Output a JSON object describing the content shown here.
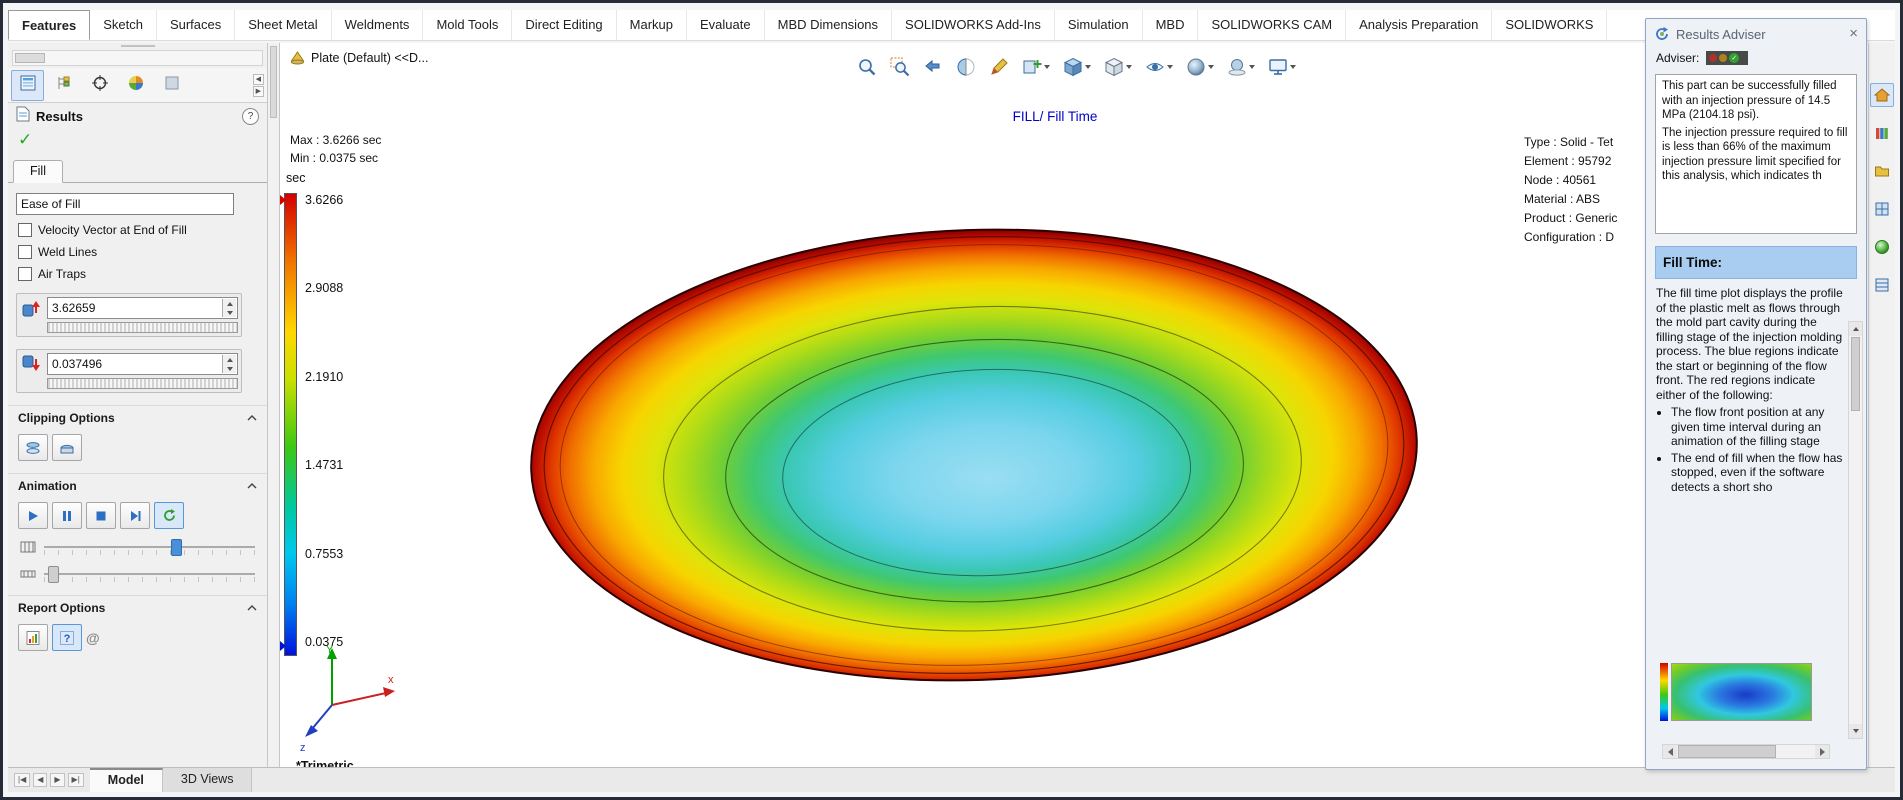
{
  "colors": {
    "plot_title_blue": "#0000cc",
    "legend_top_red": "#d40000",
    "legend_bottom_blue": "#0011dd",
    "adviser_header_bg": "#a9cdf0",
    "success_green": "#1faa1f"
  },
  "ribbon": {
    "tabs": [
      "Features",
      "Sketch",
      "Surfaces",
      "Sheet Metal",
      "Weldments",
      "Mold Tools",
      "Direct Editing",
      "Markup",
      "Evaluate",
      "MBD Dimensions",
      "SOLIDWORKS Add-Ins",
      "Simulation",
      "MBD",
      "SOLIDWORKS CAM",
      "Analysis Preparation",
      "SOLIDWORKS"
    ]
  },
  "panel": {
    "title": "Results",
    "help": "?",
    "check_glyph": "✓",
    "fill_tab": "Fill",
    "ease_of_fill": "Ease of Fill",
    "check_velocity": "Velocity Vector at End of Fill",
    "check_weld": "Weld Lines",
    "check_air": "Air Traps",
    "max_value": "3.62659",
    "min_value": "0.037496",
    "clipping_header": "Clipping Options",
    "animation_header": "Animation",
    "report_header": "Report Options",
    "at_glyph": "@",
    "tab_nav_left": "◀",
    "tab_nav_right": "▶"
  },
  "viewport": {
    "breadcrumb": "Plate (Default) <<D...",
    "plot_title": "FILL/ Fill Time",
    "max_text": "Max : 3.6266 sec",
    "min_text": "Min : 0.0375 sec",
    "view_name": "*Trimetric",
    "legend_unit": "sec",
    "legend_ticks": [
      "3.6266",
      "2.9088",
      "2.1910",
      "1.4731",
      "0.7553",
      "0.0375"
    ],
    "info_lines": [
      "Type : Solid - Tet",
      "Element : 95792",
      "Node : 40561",
      "Material : ABS",
      "Product : Generic",
      "Configuration : D"
    ],
    "axis_x": "x",
    "axis_y": "Y",
    "axis_z": "z"
  },
  "adviser": {
    "title": "Results Adviser",
    "label": "Adviser:",
    "close_glyph": "×",
    "check_glyph": "✓",
    "message_p1": "This part can be successfully filled with an injection pressure of 14.5 MPa (2104.18 psi).",
    "message_p2": "The injection pressure required to fill is less than 66% of the maximum injection pressure limit specified for this analysis, which indicates th",
    "section_title": "Fill Time:",
    "body": "The fill time plot displays the profile of the plastic melt as flows through the mold part cavity during the filling stage of the injection molding process. The blue regions indicate the start or beginning of the flow front. The red regions indicate either of the following:",
    "bullet1": "The flow front position at any given time interval during an animation of the filling stage",
    "bullet2": "The end of fill when the flow has stopped, even if the software detects a short sho"
  },
  "bottom": {
    "nav1": "|◀",
    "nav2": "◀",
    "nav3": "▶",
    "nav4": "▶|",
    "model_tab": "Model",
    "views_tab": "3D Views"
  }
}
